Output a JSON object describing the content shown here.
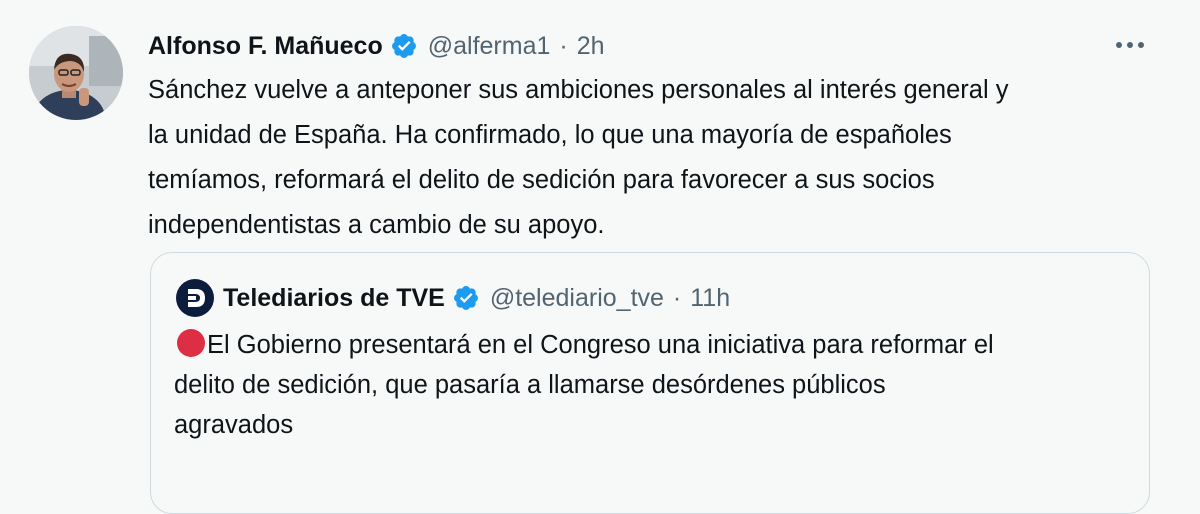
{
  "tweet": {
    "author_name": "Alfonso F. Mañueco",
    "handle": "@alferma1",
    "separator": "·",
    "time": "2h",
    "text_lines": [
      "Sánchez vuelve a anteponer sus ambiciones personales al interés general y",
      "la unidad de España. Ha confirmado, lo que una mayoría de españoles",
      "temíamos, reformará el delito de sedición para favorecer a sus socios",
      "independentistas a cambio de su apoyo."
    ]
  },
  "quote": {
    "author_name": "Telediarios de TVE",
    "handle": "@telediario_tve",
    "separator": "·",
    "time": "11h",
    "emoji": "red-circle",
    "text_lines": [
      "El Gobierno presentará en el Congreso una iniciativa para reformar el",
      "delito de sedición, que pasaría a llamarse desórdenes públicos",
      "agravados"
    ]
  },
  "colors": {
    "background": "#f7f9f9",
    "text": "#0f1419",
    "secondary_text": "#536471",
    "verified_blue": "#1d9bf0",
    "border": "#cfd9de",
    "emoji_red": "#dd2e44"
  },
  "icons": {
    "verified": "verified-badge-icon",
    "more": "more-options-icon",
    "quote_logo": "tve-logo-icon"
  }
}
